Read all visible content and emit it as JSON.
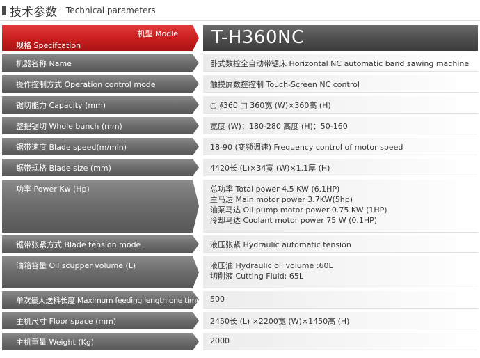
{
  "header": {
    "title_cn": "技术参数",
    "title_en": "Technical parameters"
  },
  "table_header": {
    "model_label": "机型 Modle",
    "spec_label": "规格 Specifcation",
    "model_value": "T-H360NC"
  },
  "rows": [
    {
      "label": "机器名称 Name",
      "lines": [
        "卧式数控全自动带锯床 Horizontal NC automatic band sawing machine"
      ]
    },
    {
      "label": "操作控制方式 Operation control mode",
      "lines": [
        "触摸屏数控控制 Touch-Screen NC control"
      ]
    },
    {
      "label": "锯切能力 Capacity (mm)",
      "lines": [
        "○ ∮360    □ 360宽 (W)×360高 (H)"
      ]
    },
    {
      "label": "整把锯切 Whole bunch (mm)",
      "lines": [
        "宽度 (W)：180-280    高度 (H)：50-160"
      ]
    },
    {
      "label": "锯带速度 Blade speed(m/min)",
      "lines": [
        "18-90 (变频调速) Frequency control of motor speed"
      ]
    },
    {
      "label": "锯带规格 Blade size (mm)",
      "lines": [
        "4420长 (L)×34宽 (W)×1.1厚 (H)"
      ]
    },
    {
      "label": "功率 Power Kw (Hp)",
      "lines": [
        "总功率 Total power 4.5 KW (6.1HP)",
        "主马达 Main motor power 3.7KW(5hp)",
        "油泵马达 Oil pump motor power 0.75 KW (1HP)",
        "冷却马达 Coolant motor power 75    W (0.1HP)"
      ]
    },
    {
      "label": "锯带张紧方式 Blade tension mode",
      "lines": [
        "液压张紧 Hydraulic automatic tension"
      ]
    },
    {
      "label": "油箱容量 Oil scupper volume (L)",
      "lines": [
        "液压油 Hydraulic oil volume :60L",
        "切削液 Cutting Fluid: 65L"
      ]
    },
    {
      "label": "单次最大送料长度 Maximum feeding length one time (mm)",
      "lines": [
        "500"
      ]
    },
    {
      "label": "主机尺寸 Floor space (mm)",
      "lines": [
        "2450长 (L) ×2200宽 (W)×1450高 (H)"
      ]
    },
    {
      "label": "主机重量 Weight (Kg)",
      "lines": [
        "2000"
      ]
    }
  ]
}
